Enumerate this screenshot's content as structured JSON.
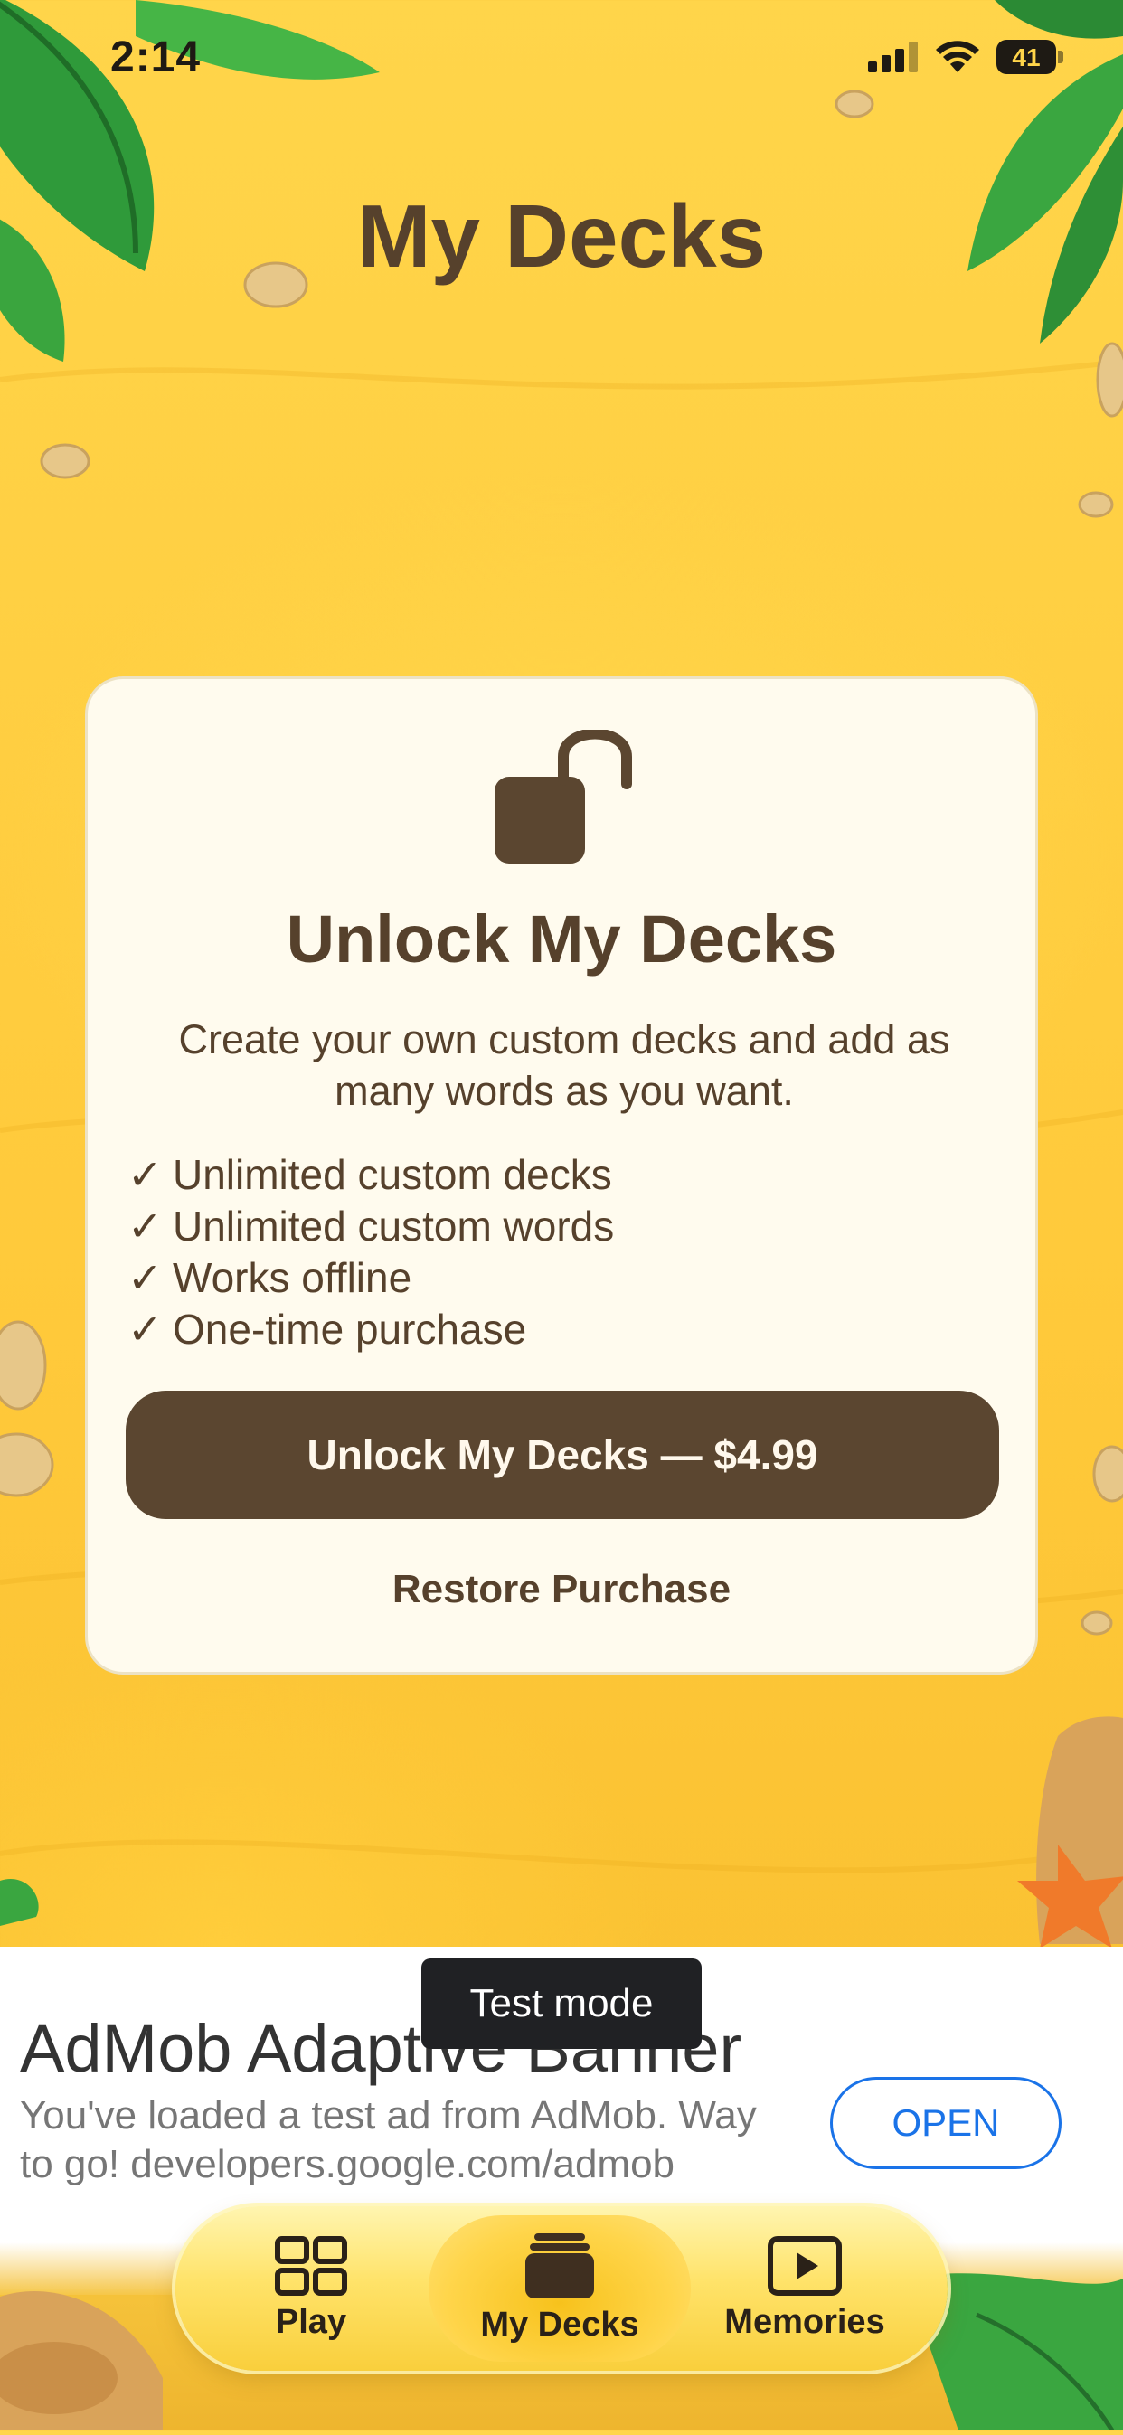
{
  "status_bar": {
    "time": "2:14",
    "battery": "41"
  },
  "page": {
    "title": "My Decks"
  },
  "paywall": {
    "title": "Unlock My Decks",
    "description": "Create your own custom decks and add as many words as you want.",
    "features": [
      {
        "check": "✓",
        "text": "Unlimited custom decks"
      },
      {
        "check": "✓",
        "text": "Unlimited custom words"
      },
      {
        "check": "✓",
        "text": "Works offline"
      },
      {
        "check": "✓",
        "text": "One-time purchase"
      }
    ],
    "buy_label": "Unlock My Decks — $4.99",
    "restore_label": "Restore Purchase",
    "icon": "lock-open-icon"
  },
  "ad": {
    "title": "AdMob Adaptive Banner",
    "text": "You've loaded a test ad from AdMob. Way to go! developers.google.com/admob",
    "open_label": "OPEN",
    "badge": "Test mode"
  },
  "tabs": [
    {
      "label": "Play",
      "icon": "grid-icon",
      "active": false
    },
    {
      "label": "My Decks",
      "icon": "stack-icon",
      "active": true
    },
    {
      "label": "Memories",
      "icon": "play-box-icon",
      "active": false
    }
  ],
  "colors": {
    "accent": "#5b4630",
    "text": "#56412c",
    "card": "#fffbee",
    "link": "#1a73e8"
  }
}
